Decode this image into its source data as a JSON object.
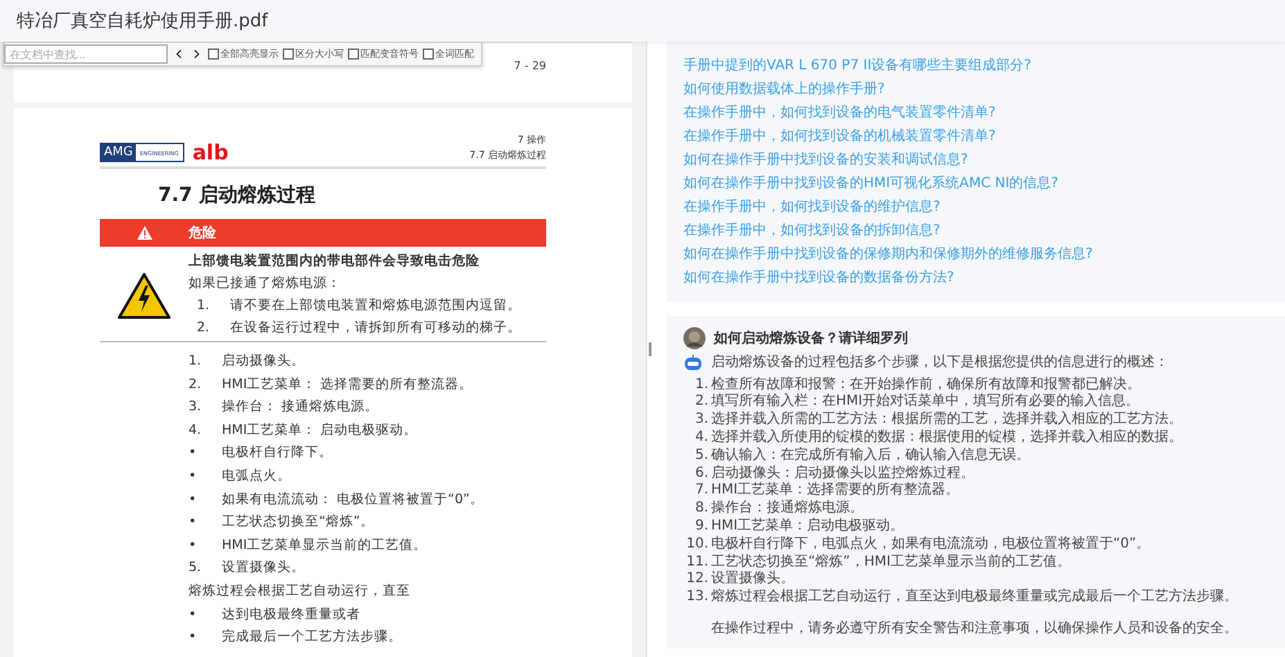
{
  "window": {
    "title": "特冶厂真空自耗炉使用手册.pdf"
  },
  "find_bar": {
    "placeholder": "在文档中查找...",
    "options": [
      {
        "label": "全部高亮显示",
        "checked": false
      },
      {
        "label": "区分大小写",
        "checked": false
      },
      {
        "label": "匹配变音符号",
        "checked": false
      },
      {
        "label": "全词匹配",
        "checked": false
      }
    ]
  },
  "pdf": {
    "previous_page": {
      "page_number": "7 - 29"
    },
    "page": {
      "logo": {
        "brand": "AMG",
        "subtitle": "ENGINEERING",
        "partner": "alb"
      },
      "chapter": "7 操作",
      "section": "7.7 启动熔炼过程",
      "heading": "7.7  启动熔炼过程",
      "danger": {
        "label": "危险",
        "title": "上部馈电装置范围内的带电部件会导致电击危险",
        "intro": "如果已接通了熔炼电源：",
        "steps": [
          {
            "number": "1.",
            "text": "请不要在上部馈电装置和熔炼电源范围内逗留。"
          },
          {
            "number": "2.",
            "text": "在设备运行过程中，请拆卸所有可移动的梯子。"
          }
        ]
      },
      "steps": [
        {
          "kind": "numbered",
          "marker": "1.",
          "text": "启动摄像头。"
        },
        {
          "kind": "numbered",
          "marker": "2.",
          "text": "HMI工艺菜单： 选择需要的所有整流器。"
        },
        {
          "kind": "numbered",
          "marker": "3.",
          "text": "操作台： 接通熔炼电源。"
        },
        {
          "kind": "numbered",
          "marker": "4.",
          "text": "HMI工艺菜单： 启动电极驱动。"
        },
        {
          "kind": "bullet",
          "marker": "•",
          "text": "电极杆自行降下。"
        },
        {
          "kind": "bullet",
          "marker": "•",
          "text": "电弧点火。"
        },
        {
          "kind": "bullet",
          "marker": "•",
          "text": "如果有电流流动： 电极位置将被置于“0”。"
        },
        {
          "kind": "bullet",
          "marker": "•",
          "text": "工艺状态切换至“熔炼”。"
        },
        {
          "kind": "bullet",
          "marker": "•",
          "text": "HMI工艺菜单显示当前的工艺值。"
        },
        {
          "kind": "numbered",
          "marker": "5.",
          "text": "设置摄像头。"
        },
        {
          "kind": "paragraph",
          "text": "熔炼过程会根据工艺自动运行，直至"
        },
        {
          "kind": "bullet",
          "marker": "•",
          "text": "达到电极最终重量或者"
        },
        {
          "kind": "bullet",
          "marker": "•",
          "text": "完成最后一个工艺方法步骤。"
        }
      ]
    }
  },
  "related_questions": [
    "手册中提到的VAR L 670 P7 II设备有哪些主要组成部分?",
    "如何使用数据载体上的操作手册?",
    "在操作手册中，如何找到设备的电气装置零件清单?",
    "在操作手册中，如何找到设备的机械装置零件清单?",
    "如何在操作手册中找到设备的安装和调试信息?",
    "如何在操作手册中找到设备的HMI可视化系统AMC NI的信息?",
    "在操作手册中，如何找到设备的维护信息?",
    "在操作手册中，如何找到设备的拆卸信息?",
    "如何在操作手册中找到设备的保修期内和保修期外的维修服务信息?",
    "如何在操作手册中找到设备的数据备份方法?"
  ],
  "chat": {
    "question": "如何启动熔炼设备？请详细罗列",
    "answer_intro": "启动熔炼设备的过程包括多个步骤，以下是根据您提供的信息进行的概述：",
    "answer_steps": [
      {
        "number": "1.",
        "text": "检查所有故障和报警：在开始操作前，确保所有故障和报警都已解决。"
      },
      {
        "number": "2.",
        "text": "填写所有输入栏：在HMI开始对话菜单中，填写所有必要的输入信息。"
      },
      {
        "number": "3.",
        "text": "选择并载入所需的工艺方法：根据所需的工艺，选择并载入相应的工艺方法。"
      },
      {
        "number": "4.",
        "text": "选择并载入所使用的锭模的数据：根据使用的锭模，选择并载入相应的数据。"
      },
      {
        "number": "5.",
        "text": "确认输入：在完成所有输入后，确认输入信息无误。"
      },
      {
        "number": "6.",
        "text": "启动摄像头：启动摄像头以监控熔炼过程。"
      },
      {
        "number": "7.",
        "text": "HMI工艺菜单：选择需要的所有整流器。"
      },
      {
        "number": "8.",
        "text": "操作台：接通熔炼电源。"
      },
      {
        "number": "9.",
        "text": "HMI工艺菜单：启动电极驱动。"
      },
      {
        "number": "10.",
        "text": "电极杆自行降下，电弧点火，如果有电流流动，电极位置将被置于“0”。"
      },
      {
        "number": "11.",
        "text": "工艺状态切换至“熔炼”，HMI工艺菜单显示当前的工艺值。"
      },
      {
        "number": "12.",
        "text": "设置摄像头。"
      },
      {
        "number": "13.",
        "text": "熔炼过程会根据工艺自动运行，直至达到电极最终重量或完成最后一个工艺方法步骤。"
      }
    ],
    "closing": "在操作过程中，请务必遵守所有安全警告和注意事项，以确保操作人员和设备的安全。"
  }
}
